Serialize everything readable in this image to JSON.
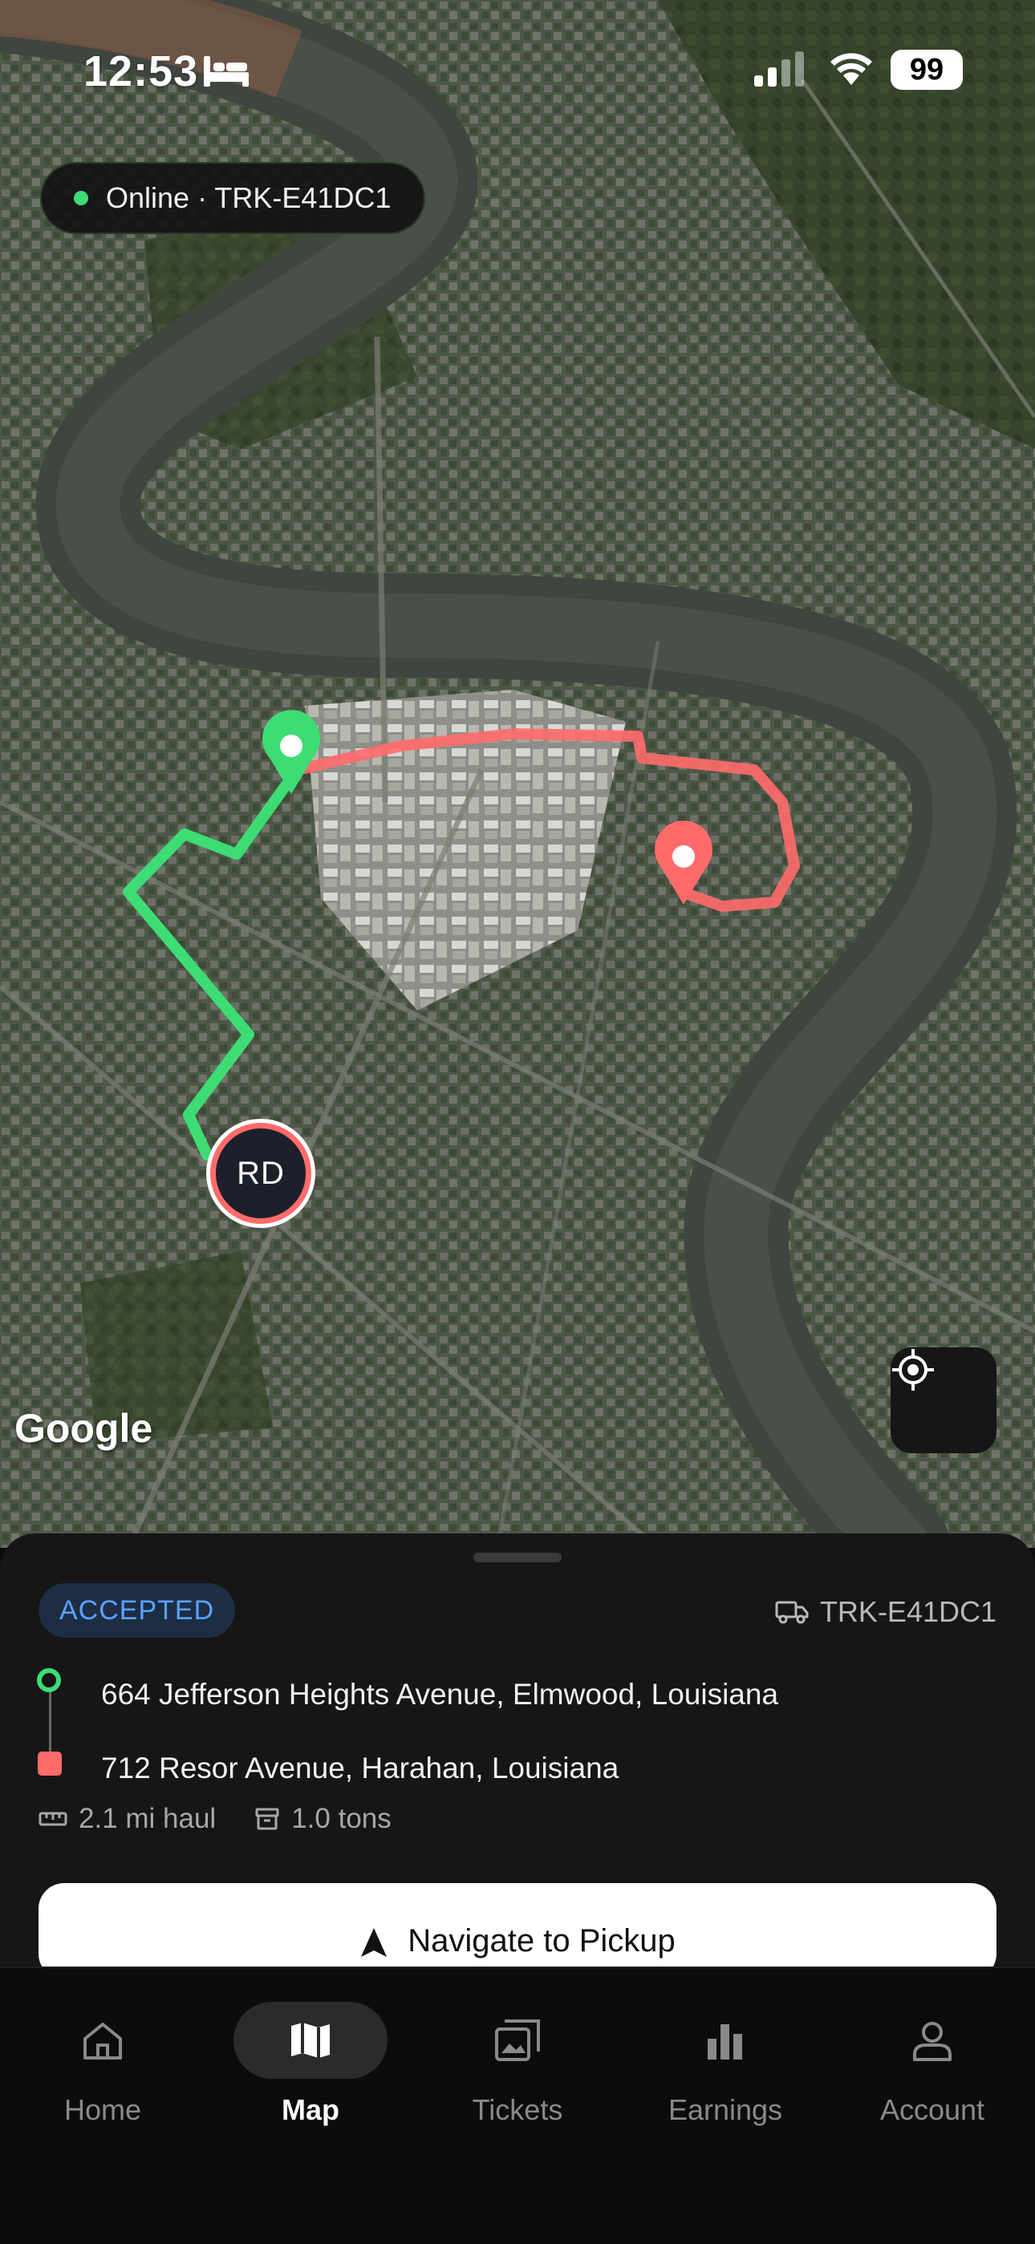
{
  "status_bar": {
    "time": "12:53",
    "battery": "99"
  },
  "online_pill": {
    "text": "Online · TRK-E41DC1"
  },
  "map": {
    "driver_initials": "RD",
    "attribution": "Google",
    "route_colors": {
      "to_pickup": "#3ddc74",
      "to_dropoff": "#ff6b6b"
    }
  },
  "job": {
    "status": "ACCEPTED",
    "truck_id": "TRK-E41DC1",
    "pickup_address": "664 Jefferson Heights Avenue, Elmwood, Louisiana",
    "dropoff_address": "712 Resor Avenue, Harahan, Louisiana",
    "distance": "2.1 mi haul",
    "weight": "1.0 tons",
    "primary_action": "Navigate to Pickup"
  },
  "nav": {
    "items": [
      {
        "label": "Home",
        "icon": "home-icon"
      },
      {
        "label": "Map",
        "icon": "map-icon",
        "active": true
      },
      {
        "label": "Tickets",
        "icon": "tickets-icon"
      },
      {
        "label": "Earnings",
        "icon": "earnings-icon"
      },
      {
        "label": "Account",
        "icon": "account-icon"
      }
    ]
  },
  "colors": {
    "accent_green": "#3ddc74",
    "accent_red": "#ff6b6b",
    "badge_blue": "#5aa2ff"
  }
}
